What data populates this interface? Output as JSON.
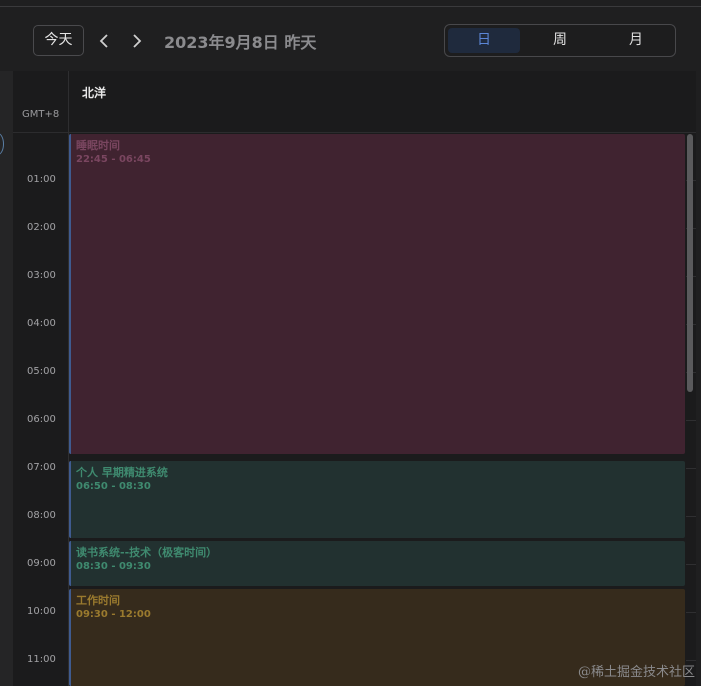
{
  "toolbar": {
    "today_label": "今天",
    "date_title": "2023年9月8日 昨天",
    "views": {
      "day": "日",
      "week": "周",
      "month": "月"
    },
    "active_view": "日"
  },
  "calendar": {
    "timezone": "GMT+8",
    "column_name": "北洋",
    "hours": [
      "01:00",
      "02:00",
      "03:00",
      "04:00",
      "05:00",
      "06:00",
      "07:00",
      "08:00",
      "09:00",
      "10:00",
      "11:00"
    ]
  },
  "events": [
    {
      "title": "睡眠时间",
      "time": "22:45 - 06:45",
      "color": "#402330"
    },
    {
      "title": "个人 早期精进系统",
      "time": "06:50 - 08:30",
      "color": "#223130"
    },
    {
      "title": "读书系统--技术（极客时间）",
      "time": "08:30 - 09:30",
      "color": "#223130"
    },
    {
      "title": "工作时间",
      "time": "09:30 - 12:00",
      "color": "#362b1c"
    }
  ],
  "watermark": "@稀土掘金技术社区",
  "colors": {
    "accent": "#5b86d6",
    "background": "#1f1f20"
  }
}
